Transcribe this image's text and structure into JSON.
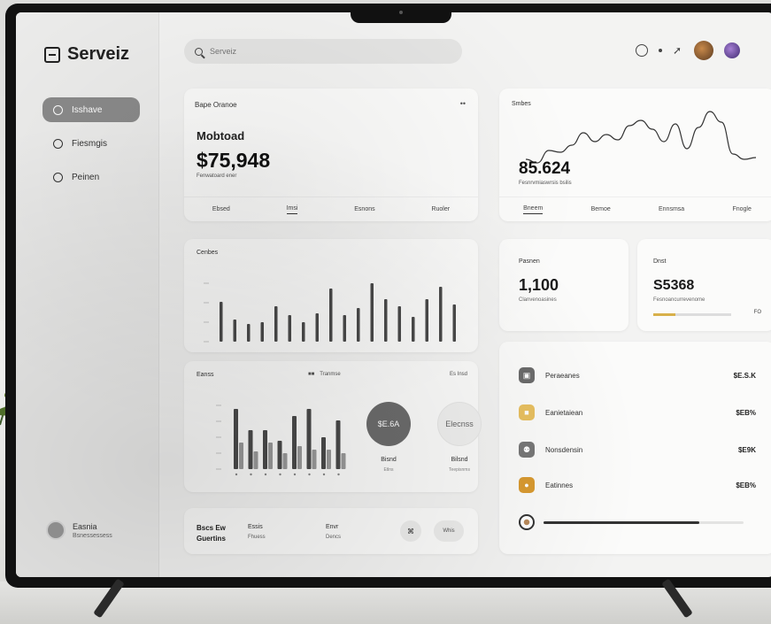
{
  "brand": "Serveiz",
  "search": {
    "placeholder": "Serveiz"
  },
  "sidebar": {
    "items": [
      {
        "label": "Isshave",
        "active": true
      },
      {
        "label": "Fiesmgis",
        "active": false
      },
      {
        "label": "Peinen",
        "active": false
      }
    ],
    "user": {
      "name": "Easnia",
      "role": "Bsnessessess"
    }
  },
  "card_revenue": {
    "header": "Bape Oranoe",
    "more": "••",
    "subtitle": "Mobtoad",
    "value": "$75,948",
    "caption": "Fenwatoard ener",
    "tabs": [
      "Ebsed",
      "Imsi",
      "Esnons",
      "Ruoler"
    ]
  },
  "card_bars": {
    "header": "Cenbes",
    "values": [
      45,
      25,
      20,
      22,
      40,
      30,
      22,
      32,
      60,
      30,
      38,
      66,
      48,
      40,
      28,
      48,
      62,
      42
    ]
  },
  "card_grouped": {
    "header": "Eanss",
    "legend1": "Tranmse",
    "legend2": "Es Insd",
    "series_a": [
      68,
      44,
      44,
      32,
      60,
      68,
      36,
      55
    ],
    "series_b": [
      30,
      20,
      30,
      18,
      26,
      22,
      22,
      18
    ],
    "donut1": {
      "value": "$E.6A",
      "label": "Bisnd",
      "sub": "Etlns"
    },
    "donut2": {
      "value": "Elecnss",
      "label": "Bilsnd",
      "sub": "Teepisnms"
    }
  },
  "card_footer": {
    "a": "Bscs Ew",
    "b": "Guertins",
    "c": "Essis",
    "d": "Fhuess",
    "e": "Envr",
    "f": "Dencs",
    "g": "⌘",
    "h": "Whis"
  },
  "card_line": {
    "header": "Smbes",
    "value": "85.624",
    "caption": "Fesnrvmiaswrsis bsilis",
    "tabs": [
      "Bneem",
      "Bemoe",
      "Ennsmsa",
      "Fnogle"
    ],
    "points": [
      30,
      26,
      40,
      38,
      46,
      60,
      50,
      58,
      52,
      68,
      74,
      64,
      50,
      70,
      42,
      66,
      84,
      72,
      36,
      30,
      32
    ]
  },
  "card_small1": {
    "header": "Pasnen",
    "value": "1,100",
    "caption": "Clanvenoasines"
  },
  "card_small2": {
    "header": "Dnst",
    "value": "S5368",
    "caption": "Fesnoancurrevenome",
    "progress": 0.28,
    "pct": "FO"
  },
  "card_list": {
    "rows": [
      {
        "name": "Peraeanes",
        "value": "$E.S.K",
        "color": "#6b6b6b",
        "icon": "▣"
      },
      {
        "name": "Eanietaiean",
        "value": "$EB%",
        "color": "#e8c060",
        "icon": "■"
      },
      {
        "name": "Nonsdensin",
        "value": "$E9K",
        "color": "#777",
        "icon": "⚉"
      },
      {
        "name": "Eatinnes",
        "value": "$EB%",
        "color": "#d99a30",
        "icon": "●"
      }
    ],
    "progress": 0.78
  },
  "colors": {
    "bar": "#4a4a4a",
    "bar_light": "#9a9a9a",
    "accent": "#d8b04a"
  }
}
